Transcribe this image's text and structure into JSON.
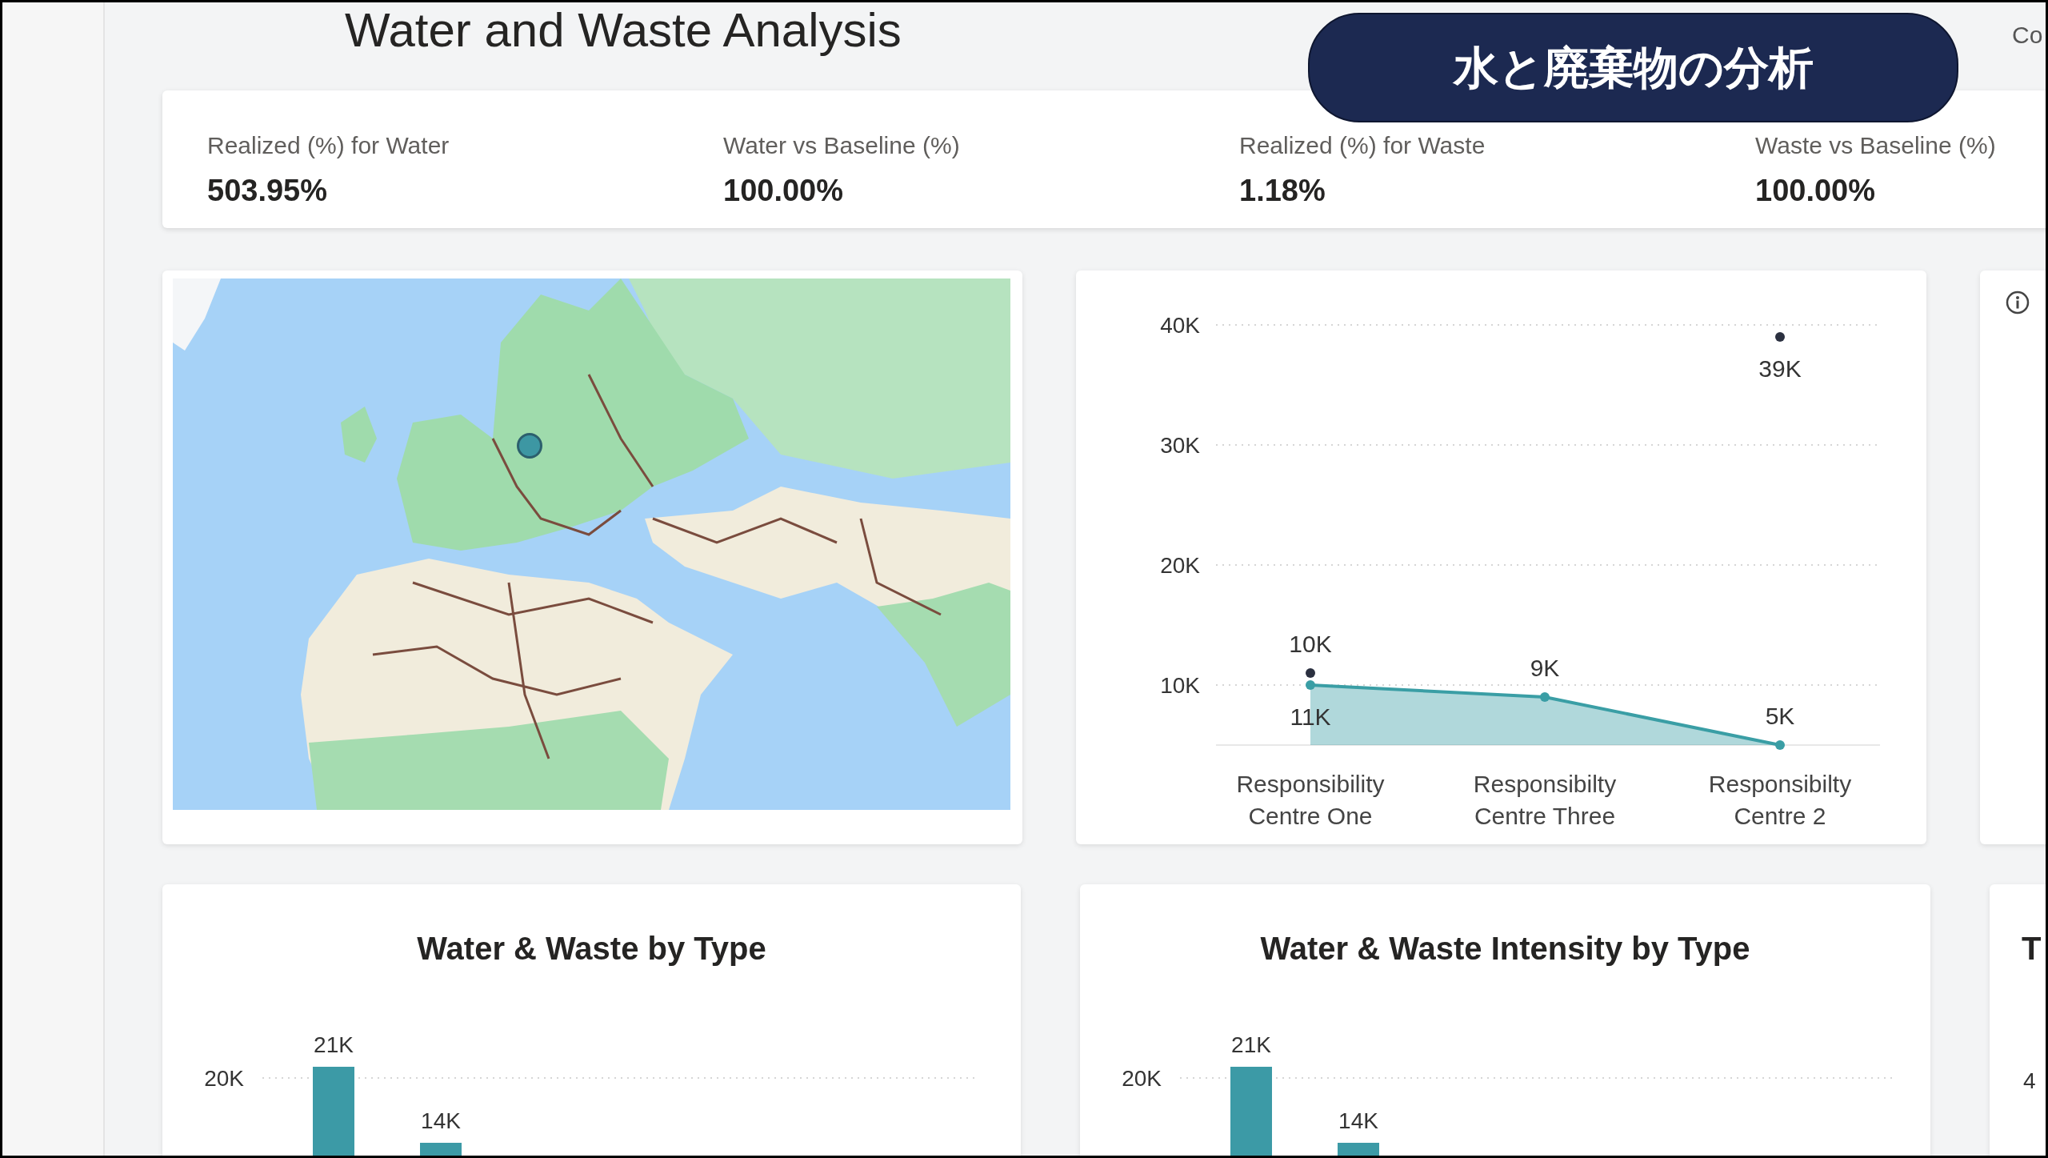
{
  "page_title": "Water and Waste Analysis",
  "header_cut_text": "Co",
  "overlay_badge": "水と廃棄物の分析",
  "kpis": [
    {
      "label": "Realized (%) for Water",
      "value": "503.95%"
    },
    {
      "label": "Water vs Baseline (%)",
      "value": "100.00%"
    },
    {
      "label": "Realized (%) for Waste",
      "value": "1.18%"
    },
    {
      "label": "Waste vs Baseline (%)",
      "value": "100.00%"
    }
  ],
  "line_chart": {
    "chart_data": {
      "type": "area",
      "categories": [
        [
          "Responsibility",
          "Centre One"
        ],
        [
          "Responsibilty",
          "Centre Three"
        ],
        [
          "Responsibilty",
          "Centre 2"
        ]
      ],
      "grid": true,
      "ylim": [
        5000,
        40000
      ],
      "yticks": [
        {
          "value": 10000,
          "label": "10K"
        },
        {
          "value": 20000,
          "label": "20K"
        },
        {
          "value": 30000,
          "label": "30K"
        },
        {
          "value": 40000,
          "label": "40K"
        }
      ],
      "series": [
        {
          "type": "area",
          "color": "#3a9ea5",
          "values": [
            10000,
            9000,
            5000
          ],
          "value_labels": [
            "10K",
            "9K",
            "5K"
          ]
        },
        {
          "type": "scatter",
          "color": "#2b3040",
          "values": [
            11000,
            null,
            39000
          ],
          "value_labels": [
            "11K",
            null,
            "39K"
          ]
        }
      ]
    }
  },
  "bar_cards": [
    {
      "title": "Water & Waste by Type",
      "gridline_label": "20K",
      "kind": "bar_picture",
      "bar_labels": [
        "21K",
        "14K"
      ]
    },
    {
      "title": "Water & Waste Intensity by Type",
      "gridline_label": "20K",
      "kind": "bar_picture",
      "bar_labels": [
        "21K",
        "14K"
      ]
    }
  ],
  "cut_card": {
    "title": "T",
    "axis_tick": "4"
  }
}
